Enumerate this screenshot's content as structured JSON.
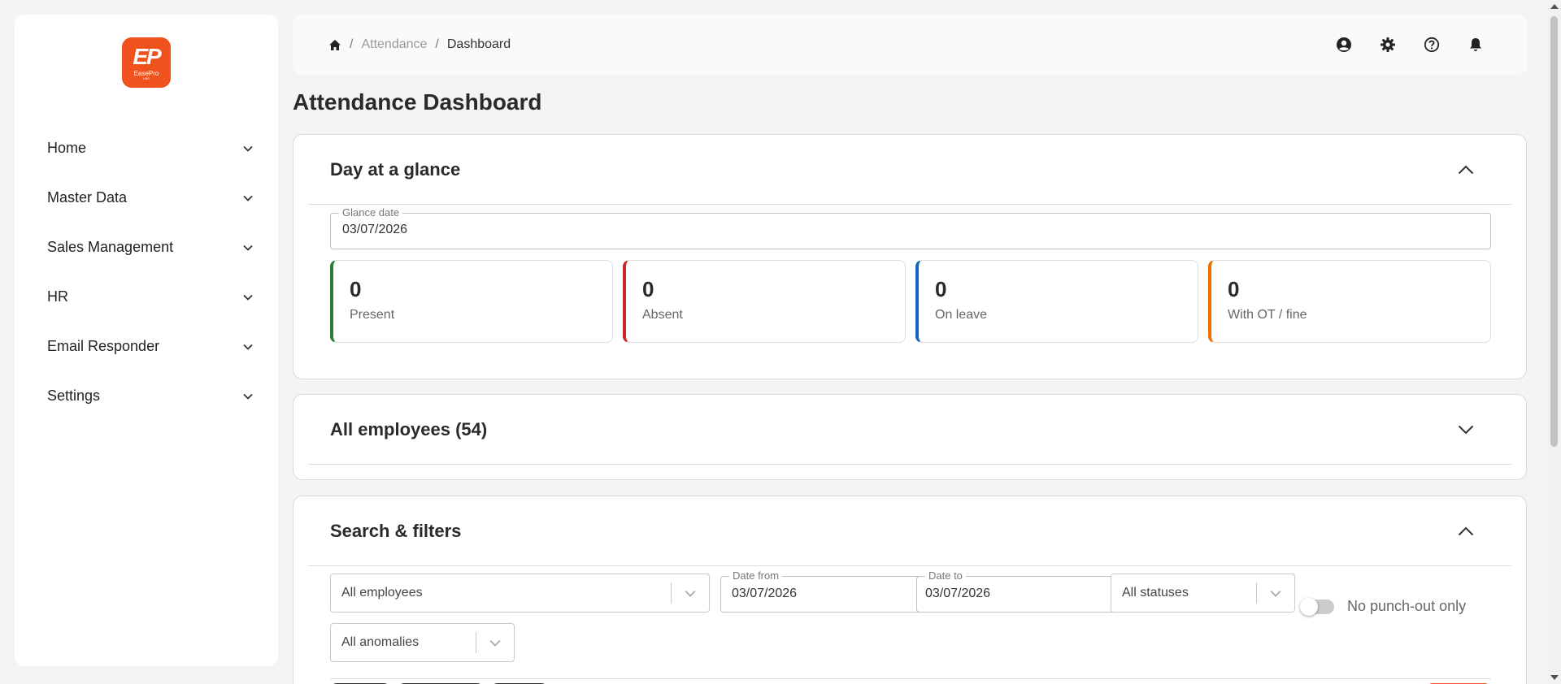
{
  "brand": {
    "logo_mark": "EP",
    "logo_text": "EasePro",
    "logo_sub": "LBS"
  },
  "sidebar": {
    "items": [
      {
        "label": "Home"
      },
      {
        "label": "Master Data"
      },
      {
        "label": "Sales Management"
      },
      {
        "label": "HR"
      },
      {
        "label": "Email Responder"
      },
      {
        "label": "Settings"
      }
    ]
  },
  "breadcrumb": {
    "home_icon": "home-icon",
    "separator": "/",
    "section": "Attendance",
    "current": "Dashboard"
  },
  "topbar_icons": [
    "user-circle-icon",
    "gear-icon",
    "help-icon",
    "bell-icon"
  ],
  "page": {
    "title": "Attendance Dashboard"
  },
  "glance": {
    "title": "Day at a glance",
    "date_label": "Glance date",
    "date_value": "03/07/2026",
    "stats": [
      {
        "value": "0",
        "label": "Present",
        "color": "#2e7d32"
      },
      {
        "value": "0",
        "label": "Absent",
        "color": "#c62828"
      },
      {
        "value": "0",
        "label": "On leave",
        "color": "#1565c0"
      },
      {
        "value": "0",
        "label": "With OT / fine",
        "color": "#ef6c00"
      }
    ]
  },
  "all_employees": {
    "title": "All employees (54)"
  },
  "filters": {
    "title": "Search & filters",
    "employee_select": "All employees",
    "date_from_label": "Date from",
    "date_from": "03/07/2026",
    "date_to_label": "Date to",
    "date_to": "03/07/2026",
    "status_select": "All statuses",
    "toggle_label": "No punch-out only",
    "anomaly_select": "All anomalies"
  },
  "colors": {
    "accent": "#f0521e"
  }
}
